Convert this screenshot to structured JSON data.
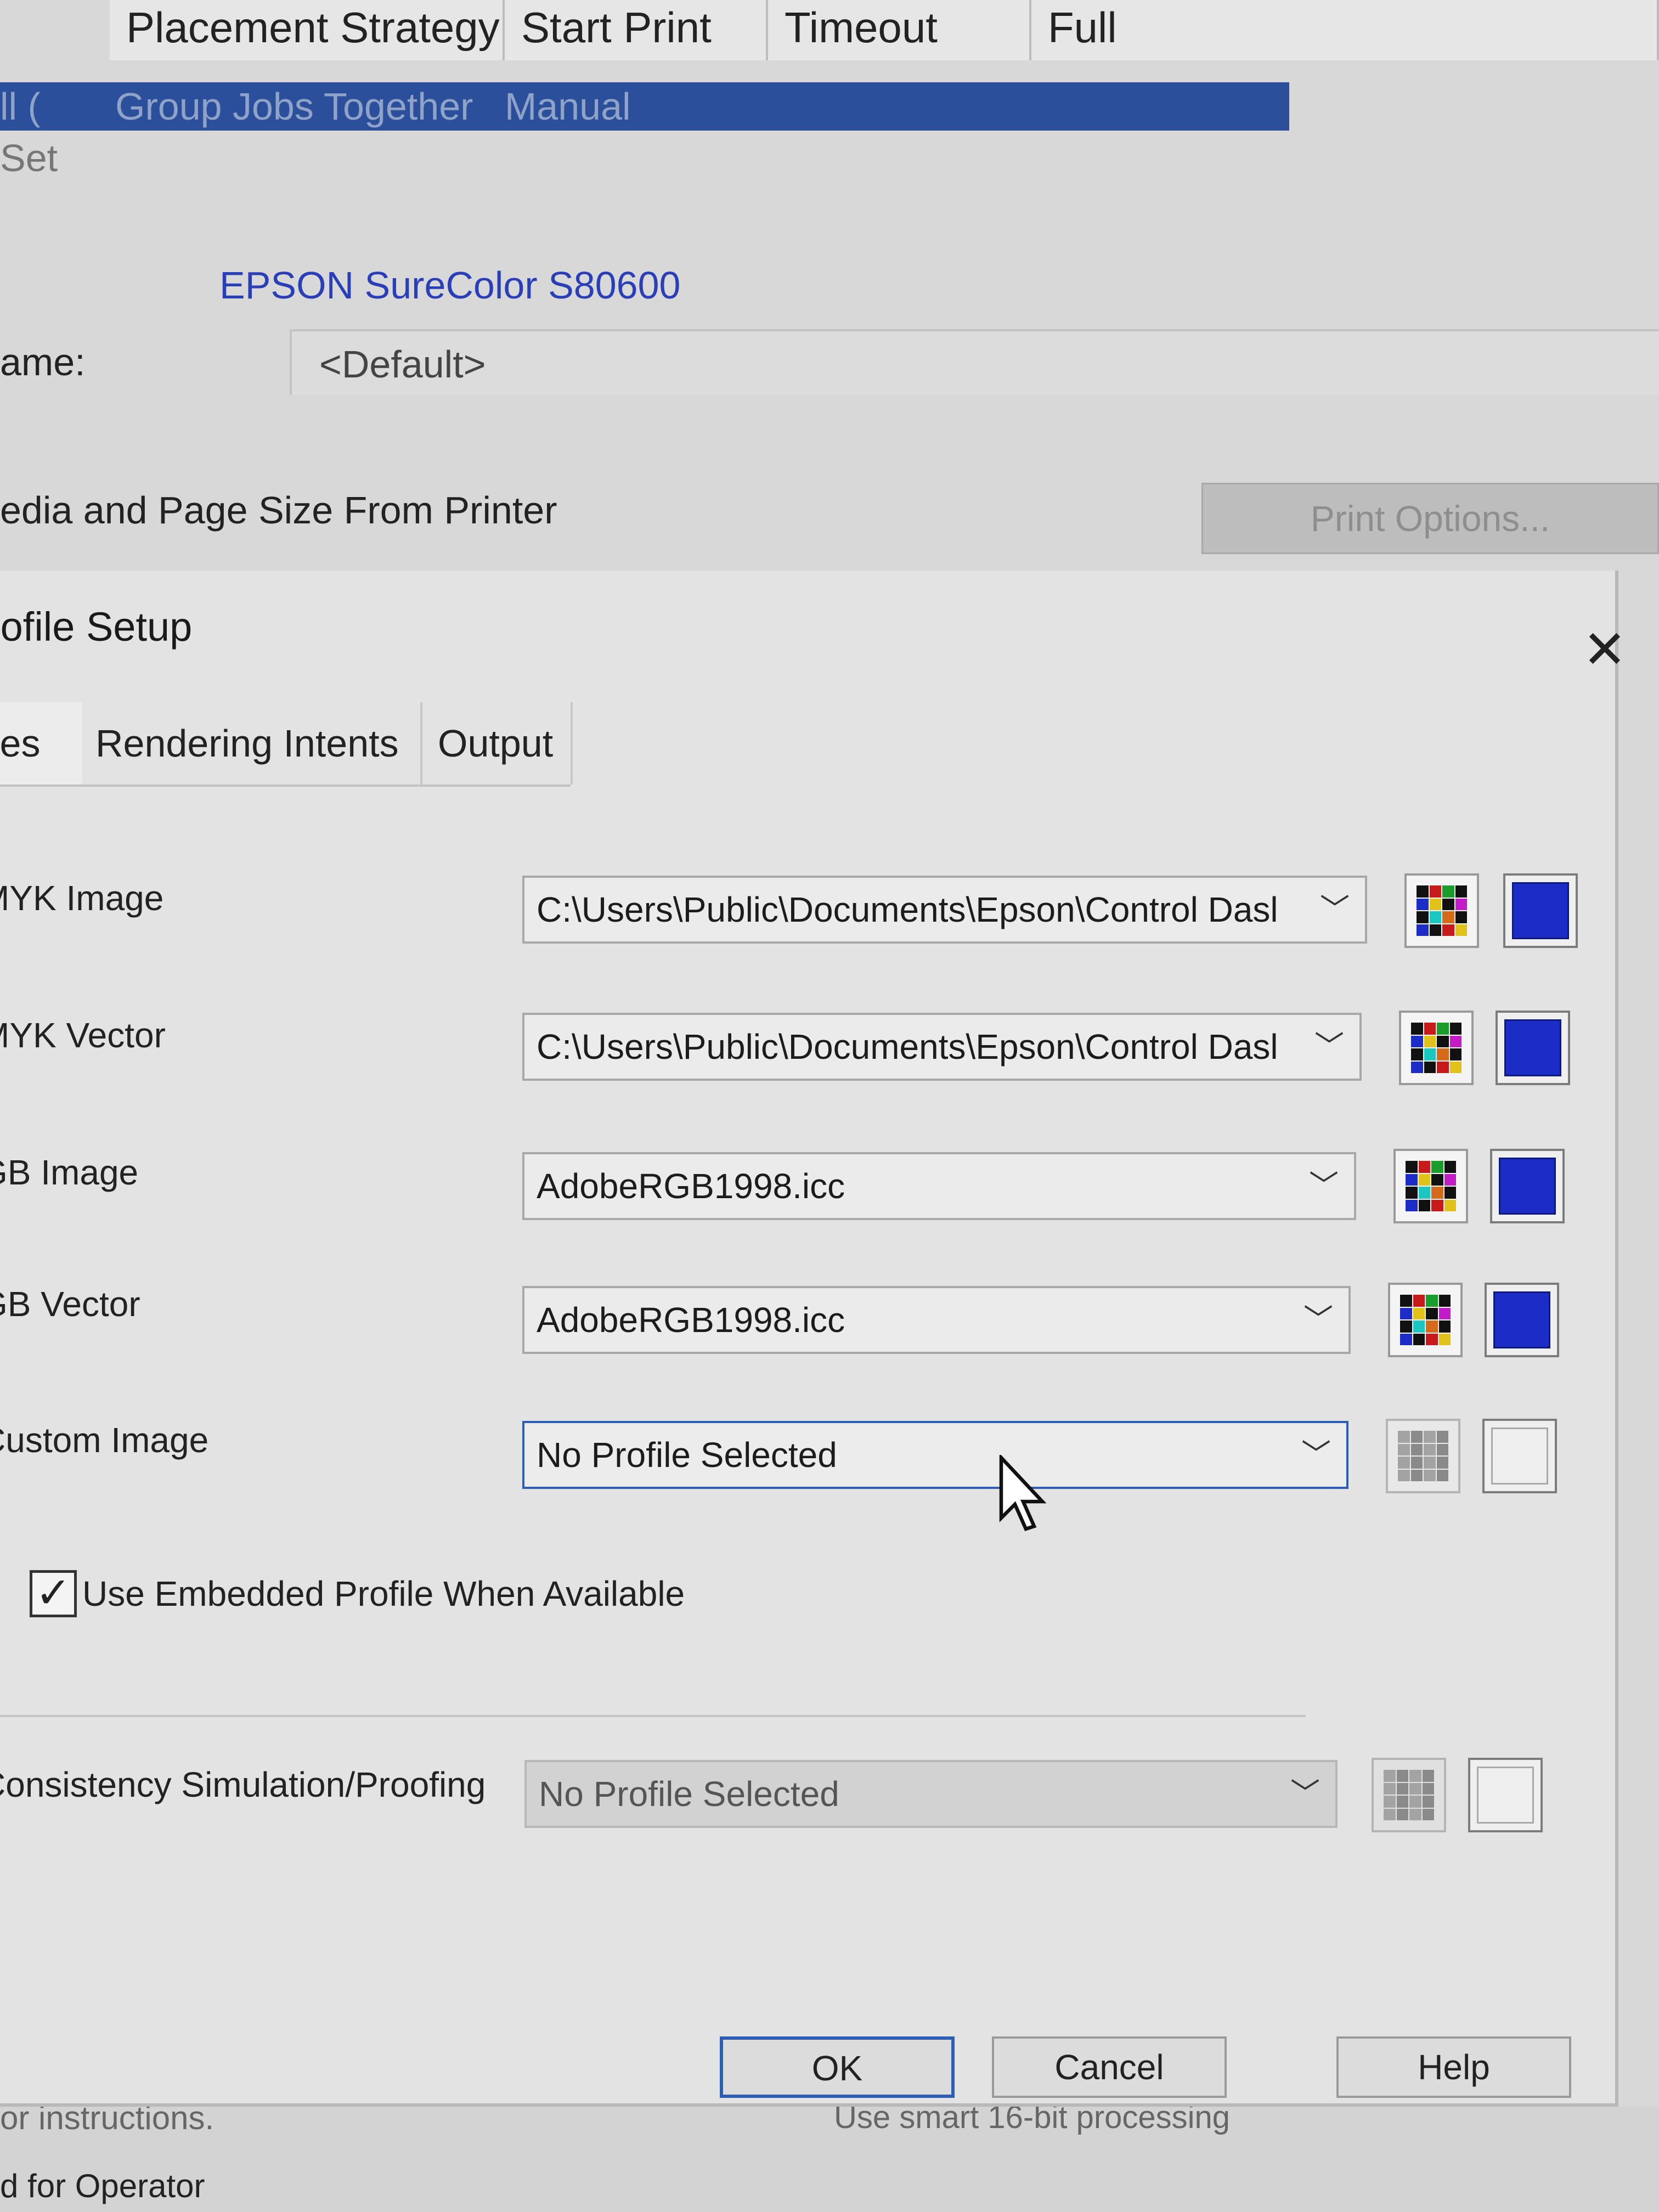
{
  "background_window": {
    "column_headers": [
      "Placement Strategy",
      "Start Print",
      "Timeout",
      "Full"
    ],
    "selected_row": [
      "ll (",
      "Group Jobs Together",
      "Manual"
    ],
    "set_label": "Set",
    "printer_name": "EPSON SureColor S80600",
    "name_label": "ame:",
    "name_value": "<Default>",
    "media_label": "edia and Page Size From Printer",
    "print_options_button": "Print Options...",
    "bottom_left_1": "or instructions.",
    "bottom_left_2": "d for Operator",
    "bottom_right": "Use smart 16-bit processing"
  },
  "dialog": {
    "title": "rofile Setup",
    "tabs": [
      "les",
      "Rendering Intents",
      "Output"
    ],
    "rows": [
      {
        "label": "MYK Image",
        "value": "C:\\Users\\Public\\Documents\\Epson\\Control Dasl",
        "has_profile": true
      },
      {
        "label": "MYK Vector",
        "value": "C:\\Users\\Public\\Documents\\Epson\\Control Dasl",
        "has_profile": true
      },
      {
        "label": "GB Image",
        "value": "AdobeRGB1998.icc",
        "has_profile": true
      },
      {
        "label": "GB Vector",
        "value": "AdobeRGB1998.icc",
        "has_profile": true
      },
      {
        "label": "Custom Image",
        "value": "No Profile Selected",
        "has_profile": false
      }
    ],
    "embedded_checkbox": {
      "label": "Use Embedded Profile When Available",
      "checked": true
    },
    "proofing": {
      "label": "Consistency Simulation/Proofing",
      "value": "No Profile Selected"
    },
    "buttons": {
      "ok": "OK",
      "cancel": "Cancel",
      "help": "Help"
    }
  },
  "colors": {
    "accent": "#2c5fb4",
    "selection_bar": "#2b4f9a",
    "profile_swatch": "#1c2cc7"
  }
}
